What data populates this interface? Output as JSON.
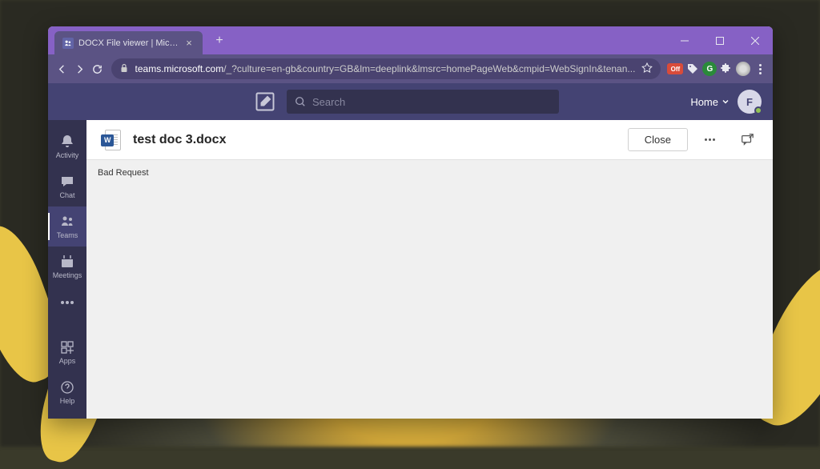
{
  "browser": {
    "tab_title": "DOCX File viewer | Microsoft Tea",
    "url_domain": "teams.microsoft.com",
    "url_path": "/_?culture=en-gb&country=GB&lm=deeplink&lmsrc=homePageWeb&cmpid=WebSignIn&tenan...",
    "ext_off": "Off",
    "ext_g": "G"
  },
  "teams": {
    "search_placeholder": "Search",
    "home_label": "Home",
    "avatar_initial": "F",
    "rail": {
      "activity": "Activity",
      "chat": "Chat",
      "teams": "Teams",
      "meetings": "Meetings",
      "apps": "Apps",
      "help": "Help"
    }
  },
  "doc": {
    "word_badge": "W",
    "title": "test doc 3.docx",
    "close_label": "Close",
    "body_text": "Bad Request"
  }
}
